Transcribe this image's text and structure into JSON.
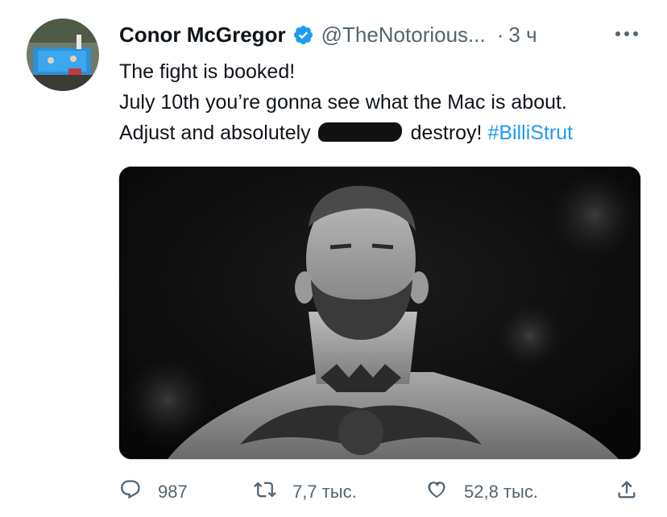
{
  "tweet": {
    "author_name": "Conor McGregor",
    "handle": "@TheNotorious...",
    "separator": "·",
    "time": "3 ч",
    "lines": [
      "The fight is booked!",
      "July 10th you’re gonna see what the Mac is about."
    ],
    "line3_before": "Adjust and absolutely",
    "line3_after": "destroy!",
    "hashtag": "#BilliStrut"
  },
  "actions": {
    "replies": "987",
    "retweets": "7,7 тыс.",
    "likes": "52,8 тыс."
  },
  "colors": {
    "accent": "#1d9bf0",
    "verified": "#1d9bf0",
    "secondary_text": "#536471",
    "primary_text": "#0f1419"
  },
  "icons": [
    "verified-badge-icon",
    "more-icon",
    "reply-icon",
    "retweet-icon",
    "like-icon",
    "share-icon"
  ]
}
